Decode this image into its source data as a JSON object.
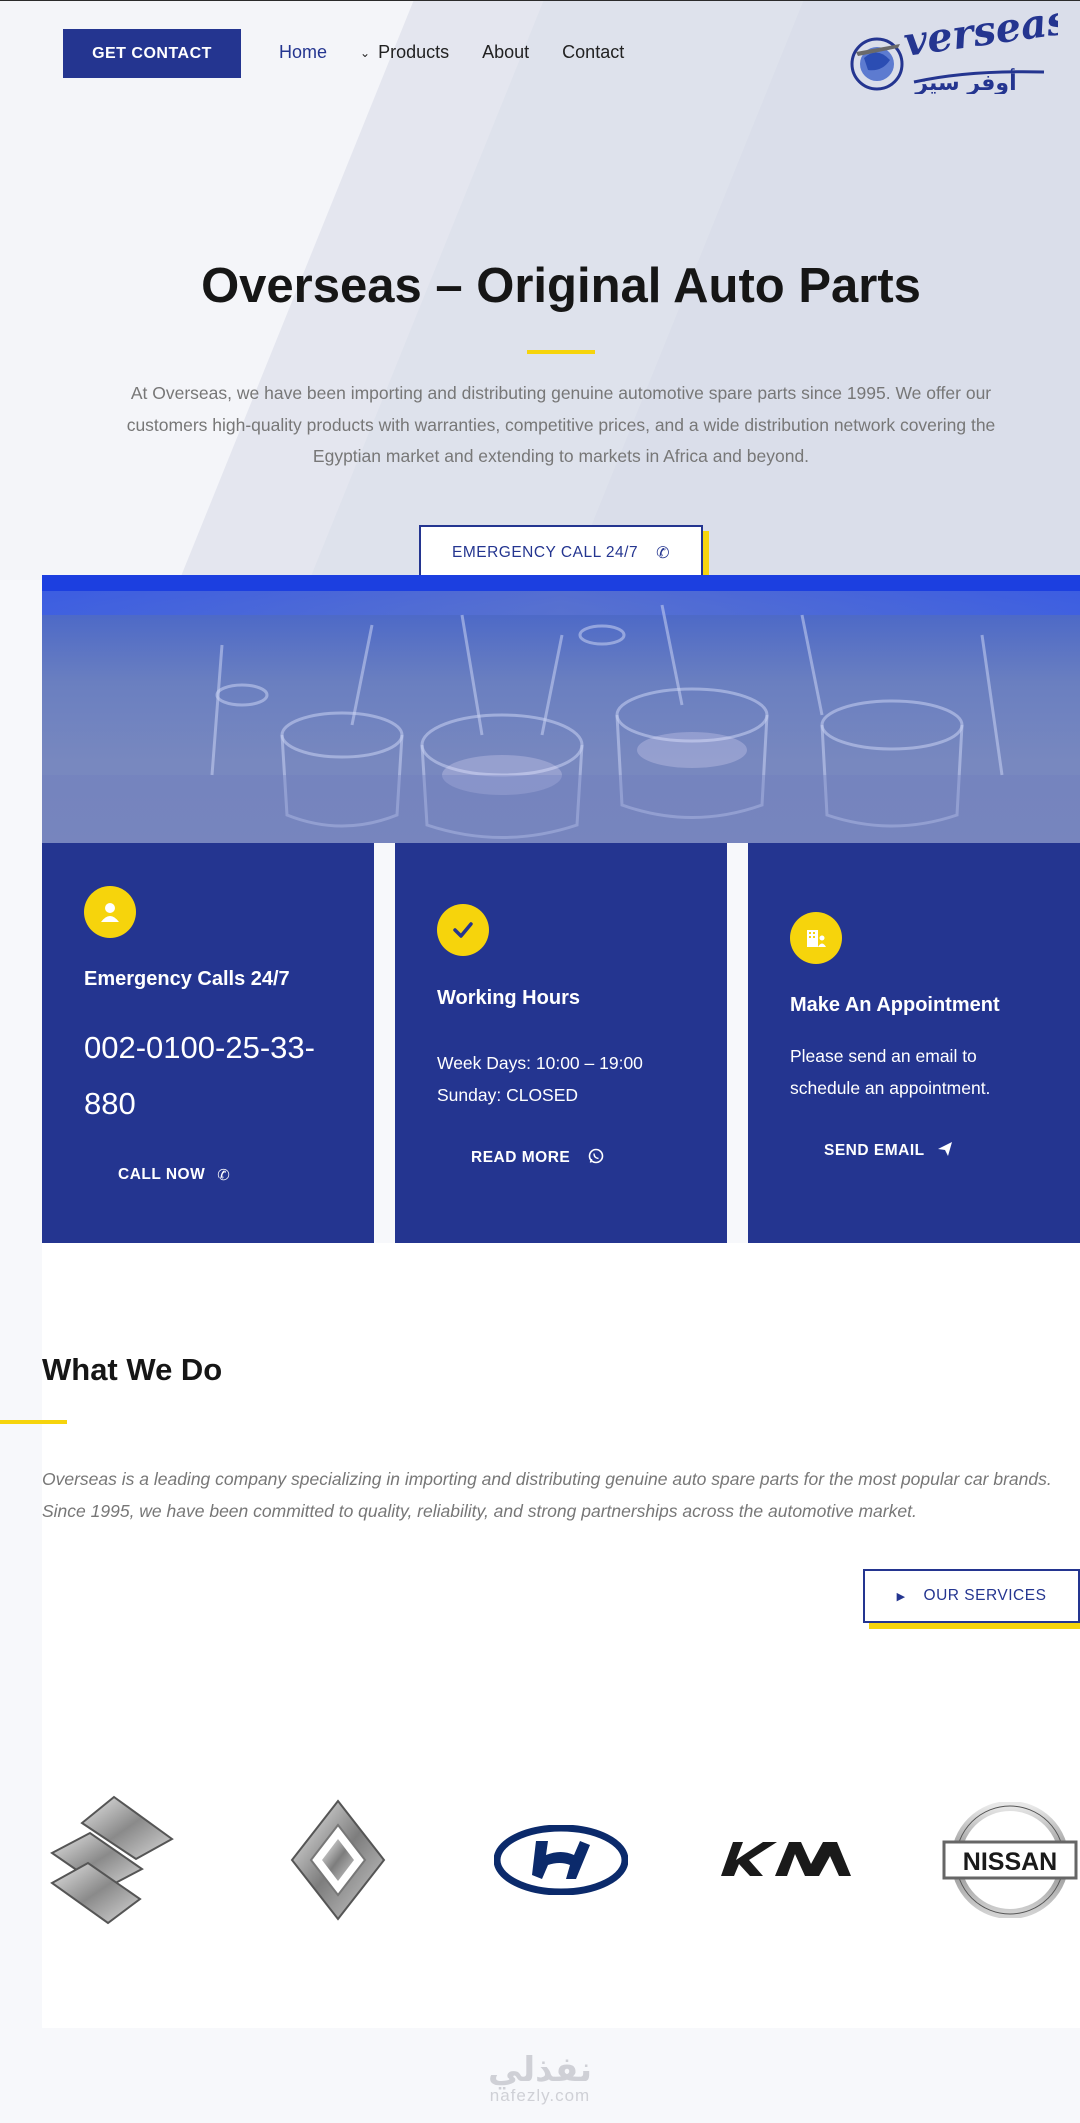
{
  "header": {
    "contact_button": "GET CONTACT",
    "nav": [
      {
        "label": "Home",
        "active": true
      },
      {
        "label": "Products",
        "has_dropdown": true
      },
      {
        "label": "About"
      },
      {
        "label": "Contact"
      }
    ],
    "logo_text": "verseas",
    "logo_arabic": "أوفر سيز"
  },
  "hero": {
    "title": "Overseas – Original Auto Parts",
    "description": "At Overseas, we have been importing and distributing genuine automotive spare parts since 1995. We offer our customers high-quality products with warranties, competitive prices, and a wide distribution network covering the Egyptian market and extending to markets in Africa and beyond.",
    "button": "EMERGENCY CALL 24/7"
  },
  "cards": [
    {
      "title": "Emergency Calls 24/7",
      "phone": "002-0100-25-33-880",
      "cta": "CALL NOW",
      "icon": "person-icon"
    },
    {
      "title": "Working Hours",
      "lines": [
        "Week Days: 10:00 – 19:00",
        "Sunday: CLOSED"
      ],
      "cta": "READ MORE",
      "icon": "check-icon"
    },
    {
      "title": "Make An Appointment",
      "text": "Please send an email to schedule an appointment.",
      "cta": "SEND EMAIL",
      "icon": "building-icon"
    }
  ],
  "what_we_do": {
    "title": "What We Do",
    "text": "Overseas is a leading company specializing in importing and distributing genuine auto spare parts for the most popular car brands. Since 1995, we have been committed to quality, reliability, and strong partnerships across the automotive market.",
    "button": "OUR SERVICES"
  },
  "brands": [
    {
      "name": "suzuki-logo"
    },
    {
      "name": "renault-logo"
    },
    {
      "name": "hyundai-logo"
    },
    {
      "name": "kia-logo",
      "text": "KIA"
    },
    {
      "name": "nissan-logo",
      "text": "NISSAN"
    }
  ],
  "watermark": {
    "arabic": "نفذلي",
    "latin": "nafezly.com"
  },
  "colors": {
    "brand_blue": "#243590",
    "accent_yellow": "#f6d40c",
    "text_gray": "#777777"
  }
}
